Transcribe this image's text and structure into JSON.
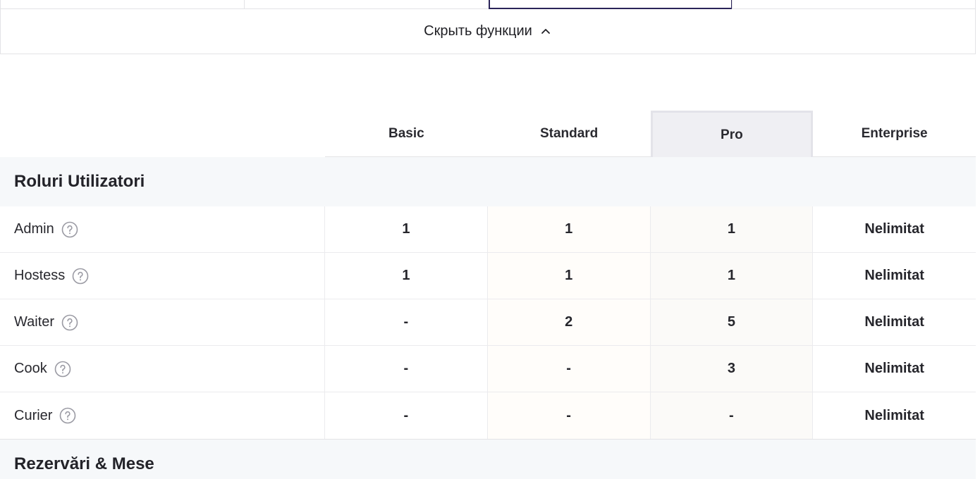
{
  "toggle": {
    "label": "Скрыть функции"
  },
  "plans": [
    "Basic",
    "Standard",
    "Pro",
    "Enterprise"
  ],
  "active_plan": "Pro",
  "sections": [
    {
      "title": "Roluri Utilizatori"
    },
    {
      "title": "Rezervări & Mese"
    }
  ],
  "rows": [
    {
      "label": "Admin",
      "values": [
        "1",
        "1",
        "1",
        "Nelimitat"
      ]
    },
    {
      "label": "Hostess",
      "values": [
        "1",
        "1",
        "1",
        "Nelimitat"
      ]
    },
    {
      "label": "Waiter",
      "values": [
        "-",
        "2",
        "5",
        "Nelimitat"
      ]
    },
    {
      "label": "Cook",
      "values": [
        "-",
        "-",
        "3",
        "Nelimitat"
      ]
    },
    {
      "label": "Curier",
      "values": [
        "-",
        "-",
        "-",
        "Nelimitat"
      ]
    }
  ],
  "colors": {
    "accent_border": "#2b2459",
    "active_plan_bg": "#efeff3",
    "section_bg": "#f6f8fa"
  },
  "icons": {
    "toggle": "chevron-up-icon",
    "help": "question-circle-icon"
  }
}
